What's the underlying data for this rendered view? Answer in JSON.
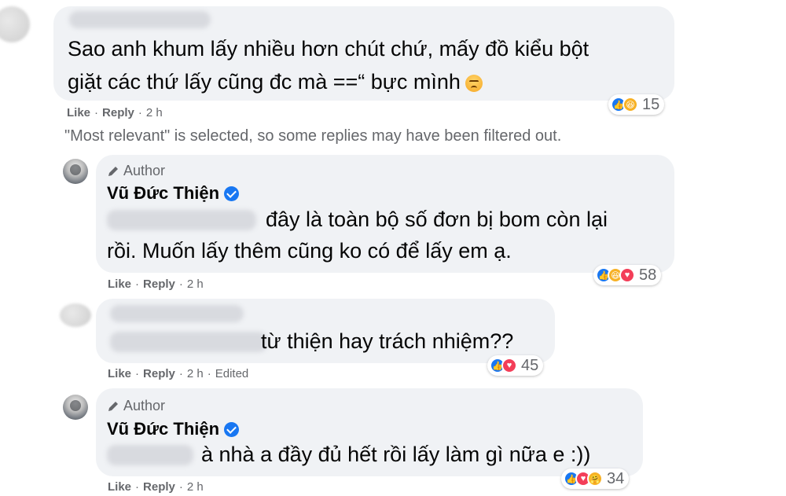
{
  "comments": [
    {
      "text_lines": [
        "Sao anh khum lấy nhiều hơn chút chứ, mấy đồ kiểu bột",
        "giặt các thứ lấy cũng đc mà ==“ bực mình"
      ],
      "actions": {
        "like": "Like",
        "reply": "Reply",
        "time": "2 h"
      },
      "reactions": {
        "icons": [
          "like-icon",
          "haha-icon"
        ],
        "count": "15"
      }
    },
    {
      "filter_note": "\"Most relevant\" is selected, so some replies may have been filtered out."
    },
    {
      "author_badge": "Author",
      "name": "Vũ Đức Thiện",
      "text_lines": [
        "đây là toàn bộ số đơn bị bom còn lại",
        "rồi. Muốn lấy thêm cũng ko có để lấy em ạ."
      ],
      "actions": {
        "like": "Like",
        "reply": "Reply",
        "time": "2 h"
      },
      "reactions": {
        "icons": [
          "like-icon",
          "haha-icon",
          "love-icon"
        ],
        "count": "58"
      }
    },
    {
      "text_lines": [
        "từ thiện hay trách nhiệm??"
      ],
      "actions": {
        "like": "Like",
        "reply": "Reply",
        "time": "2 h",
        "edited": "Edited"
      },
      "reactions": {
        "icons": [
          "like-icon",
          "love-icon"
        ],
        "count": "45"
      }
    },
    {
      "author_badge": "Author",
      "name": "Vũ Đức Thiện",
      "text_lines": [
        "à nhà a đầy đủ hết rồi lấy làm gì nữa e :))"
      ],
      "actions": {
        "like": "Like",
        "reply": "Reply",
        "time": "2 h"
      },
      "reactions": {
        "icons": [
          "like-icon",
          "love-icon",
          "care-icon"
        ],
        "count": "34"
      }
    }
  ],
  "colors": {
    "bubble": "#f0f2f5",
    "meta_text": "#65676b",
    "like_blue": "#1877f2",
    "love_red": "#f33e58",
    "haha_yellow": "#f7b125"
  }
}
